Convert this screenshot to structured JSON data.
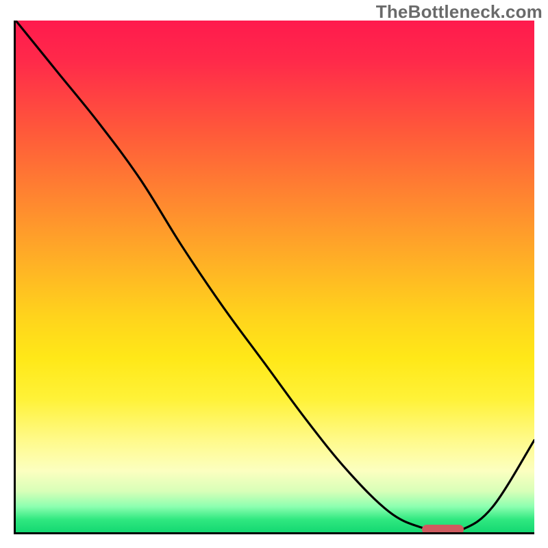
{
  "watermark": "TheBottleneck.com",
  "chart_data": {
    "type": "line",
    "title": "",
    "xlabel": "",
    "ylabel": "",
    "xlim": [
      0,
      100
    ],
    "ylim": [
      0,
      100
    ],
    "grid": false,
    "legend": false,
    "series": [
      {
        "name": "bottleneck-curve",
        "x": [
          0,
          8,
          16,
          24,
          32,
          40,
          48,
          56,
          64,
          72,
          78,
          82,
          86,
          92,
          100
        ],
        "y": [
          100,
          90,
          80,
          69,
          56,
          44,
          33,
          22,
          12,
          4,
          1,
          0.5,
          0.5,
          5,
          18
        ]
      }
    ],
    "marker": {
      "name": "optimal-range",
      "x_start": 78,
      "x_end": 86,
      "y": 0.9,
      "color": "#cf5b5f"
    },
    "background_gradient": {
      "stops": [
        {
          "pct": 0,
          "color": "#ff1a4d"
        },
        {
          "pct": 22,
          "color": "#ff5a3a"
        },
        {
          "pct": 48,
          "color": "#ffb325"
        },
        {
          "pct": 74,
          "color": "#fff238"
        },
        {
          "pct": 92,
          "color": "#d8ffb8"
        },
        {
          "pct": 100,
          "color": "#14d872"
        }
      ]
    }
  }
}
